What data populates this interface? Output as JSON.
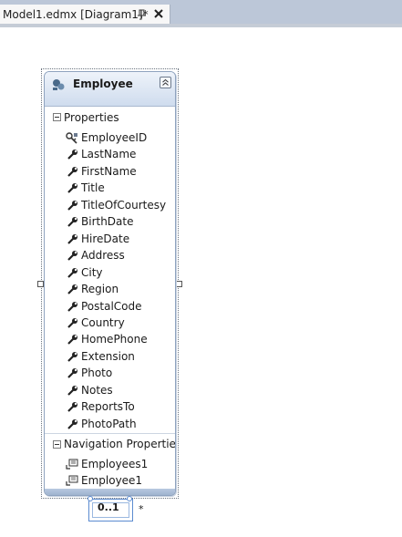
{
  "tab": {
    "title": "Model1.edmx [Diagram1]*"
  },
  "entity": {
    "name": "Employee",
    "properties_label": "Properties",
    "properties": [
      {
        "name": "EmployeeID",
        "key": true
      },
      {
        "name": "LastName",
        "key": false
      },
      {
        "name": "FirstName",
        "key": false
      },
      {
        "name": "Title",
        "key": false
      },
      {
        "name": "TitleOfCourtesy",
        "key": false
      },
      {
        "name": "BirthDate",
        "key": false
      },
      {
        "name": "HireDate",
        "key": false
      },
      {
        "name": "Address",
        "key": false
      },
      {
        "name": "City",
        "key": false
      },
      {
        "name": "Region",
        "key": false
      },
      {
        "name": "PostalCode",
        "key": false
      },
      {
        "name": "Country",
        "key": false
      },
      {
        "name": "HomePhone",
        "key": false
      },
      {
        "name": "Extension",
        "key": false
      },
      {
        "name": "Photo",
        "key": false
      },
      {
        "name": "Notes",
        "key": false
      },
      {
        "name": "ReportsTo",
        "key": false
      },
      {
        "name": "PhotoPath",
        "key": false
      }
    ],
    "navigation_label": "Navigation Properties",
    "navigation": [
      {
        "name": "Employees1"
      },
      {
        "name": "Employee1"
      }
    ]
  },
  "association": {
    "multiplicity_left": "0..1",
    "multiplicity_right": "*"
  },
  "icons": {
    "pin": "pin-icon",
    "close": "close-icon",
    "entity": "entity-type-icon",
    "collapse": "collapse-chevrons-icon",
    "property": "wrench-property-icon",
    "key_property": "key-property-icon",
    "navigation": "navigation-property-icon"
  },
  "colors": {
    "tabstrip": "#bcc7d8",
    "entity_header": "#cfdcee",
    "entity_border": "#8fa3bf",
    "connector": "#5b8bd0"
  }
}
